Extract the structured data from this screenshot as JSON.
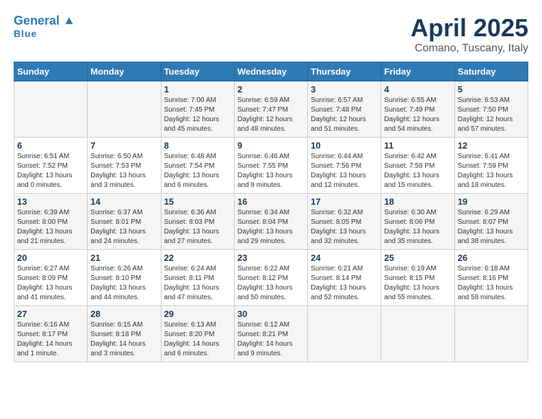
{
  "logo": {
    "part1": "General",
    "part2": "Blue"
  },
  "title": "April 2025",
  "location": "Comano, Tuscany, Italy",
  "days_of_week": [
    "Sunday",
    "Monday",
    "Tuesday",
    "Wednesday",
    "Thursday",
    "Friday",
    "Saturday"
  ],
  "weeks": [
    [
      {
        "day": "",
        "info": ""
      },
      {
        "day": "",
        "info": ""
      },
      {
        "day": "1",
        "info": "Sunrise: 7:00 AM\nSunset: 7:45 PM\nDaylight: 12 hours and 45 minutes."
      },
      {
        "day": "2",
        "info": "Sunrise: 6:59 AM\nSunset: 7:47 PM\nDaylight: 12 hours and 48 minutes."
      },
      {
        "day": "3",
        "info": "Sunrise: 6:57 AM\nSunset: 7:48 PM\nDaylight: 12 hours and 51 minutes."
      },
      {
        "day": "4",
        "info": "Sunrise: 6:55 AM\nSunset: 7:49 PM\nDaylight: 12 hours and 54 minutes."
      },
      {
        "day": "5",
        "info": "Sunrise: 6:53 AM\nSunset: 7:50 PM\nDaylight: 12 hours and 57 minutes."
      }
    ],
    [
      {
        "day": "6",
        "info": "Sunrise: 6:51 AM\nSunset: 7:52 PM\nDaylight: 13 hours and 0 minutes."
      },
      {
        "day": "7",
        "info": "Sunrise: 6:50 AM\nSunset: 7:53 PM\nDaylight: 13 hours and 3 minutes."
      },
      {
        "day": "8",
        "info": "Sunrise: 6:48 AM\nSunset: 7:54 PM\nDaylight: 13 hours and 6 minutes."
      },
      {
        "day": "9",
        "info": "Sunrise: 6:46 AM\nSunset: 7:55 PM\nDaylight: 13 hours and 9 minutes."
      },
      {
        "day": "10",
        "info": "Sunrise: 6:44 AM\nSunset: 7:56 PM\nDaylight: 13 hours and 12 minutes."
      },
      {
        "day": "11",
        "info": "Sunrise: 6:42 AM\nSunset: 7:58 PM\nDaylight: 13 hours and 15 minutes."
      },
      {
        "day": "12",
        "info": "Sunrise: 6:41 AM\nSunset: 7:59 PM\nDaylight: 13 hours and 18 minutes."
      }
    ],
    [
      {
        "day": "13",
        "info": "Sunrise: 6:39 AM\nSunset: 8:00 PM\nDaylight: 13 hours and 21 minutes."
      },
      {
        "day": "14",
        "info": "Sunrise: 6:37 AM\nSunset: 8:01 PM\nDaylight: 13 hours and 24 minutes."
      },
      {
        "day": "15",
        "info": "Sunrise: 6:36 AM\nSunset: 8:03 PM\nDaylight: 13 hours and 27 minutes."
      },
      {
        "day": "16",
        "info": "Sunrise: 6:34 AM\nSunset: 8:04 PM\nDaylight: 13 hours and 29 minutes."
      },
      {
        "day": "17",
        "info": "Sunrise: 6:32 AM\nSunset: 8:05 PM\nDaylight: 13 hours and 32 minutes."
      },
      {
        "day": "18",
        "info": "Sunrise: 6:30 AM\nSunset: 8:06 PM\nDaylight: 13 hours and 35 minutes."
      },
      {
        "day": "19",
        "info": "Sunrise: 6:29 AM\nSunset: 8:07 PM\nDaylight: 13 hours and 38 minutes."
      }
    ],
    [
      {
        "day": "20",
        "info": "Sunrise: 6:27 AM\nSunset: 8:09 PM\nDaylight: 13 hours and 41 minutes."
      },
      {
        "day": "21",
        "info": "Sunrise: 6:26 AM\nSunset: 8:10 PM\nDaylight: 13 hours and 44 minutes."
      },
      {
        "day": "22",
        "info": "Sunrise: 6:24 AM\nSunset: 8:11 PM\nDaylight: 13 hours and 47 minutes."
      },
      {
        "day": "23",
        "info": "Sunrise: 6:22 AM\nSunset: 8:12 PM\nDaylight: 13 hours and 50 minutes."
      },
      {
        "day": "24",
        "info": "Sunrise: 6:21 AM\nSunset: 8:14 PM\nDaylight: 13 hours and 52 minutes."
      },
      {
        "day": "25",
        "info": "Sunrise: 6:19 AM\nSunset: 8:15 PM\nDaylight: 13 hours and 55 minutes."
      },
      {
        "day": "26",
        "info": "Sunrise: 6:18 AM\nSunset: 8:16 PM\nDaylight: 13 hours and 58 minutes."
      }
    ],
    [
      {
        "day": "27",
        "info": "Sunrise: 6:16 AM\nSunset: 8:17 PM\nDaylight: 14 hours and 1 minute."
      },
      {
        "day": "28",
        "info": "Sunrise: 6:15 AM\nSunset: 8:18 PM\nDaylight: 14 hours and 3 minutes."
      },
      {
        "day": "29",
        "info": "Sunrise: 6:13 AM\nSunset: 8:20 PM\nDaylight: 14 hours and 6 minutes."
      },
      {
        "day": "30",
        "info": "Sunrise: 6:12 AM\nSunset: 8:21 PM\nDaylight: 14 hours and 9 minutes."
      },
      {
        "day": "",
        "info": ""
      },
      {
        "day": "",
        "info": ""
      },
      {
        "day": "",
        "info": ""
      }
    ]
  ]
}
